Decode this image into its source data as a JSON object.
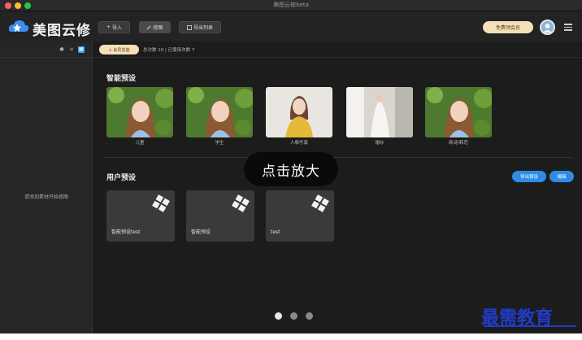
{
  "window": {
    "title": "美图云修beta"
  },
  "toolbar": {
    "brand": "美图云修",
    "import_label": "导入",
    "preset_label": "修图",
    "export_list_label": "导出列表",
    "free_pill_label": "免费领会员",
    "avatar_icon": "user-avatar",
    "menu_icon": "hamburger-icon"
  },
  "sidebar": {
    "empty_text": "请添加素材开始修图",
    "icons": [
      "info-icon",
      "list-view-icon",
      "grid-view-icon"
    ]
  },
  "subbar": {
    "member_pill": "+ 会员充值",
    "counts_text": "总次数 10  |  已使用次数 7"
  },
  "smart_presets": {
    "title": "智能预设",
    "items": [
      {
        "label": "儿童",
        "style": "greenery"
      },
      {
        "label": "学生",
        "style": "greenery"
      },
      {
        "label": "人像写真",
        "style": "yellow-dress"
      },
      {
        "label": "婚纱",
        "style": "bridal"
      },
      {
        "label": "新诗/韩范",
        "style": "greenery"
      }
    ]
  },
  "user_presets": {
    "title": "用户预设",
    "export_button": "导出预设",
    "edit_button": "编辑",
    "cards": [
      {
        "name": "智能预设test"
      },
      {
        "name": "智能预设"
      },
      {
        "name": "test"
      }
    ]
  },
  "tooltip": {
    "text": "点击放大"
  },
  "pager": {
    "count": 3,
    "active": 1
  },
  "watermark": {
    "text": "最需教育"
  },
  "colors": {
    "accent_blue": "#2f8ce6",
    "gold_pill": "#f3e0b8",
    "watermark_blue": "#1f3cc9"
  }
}
